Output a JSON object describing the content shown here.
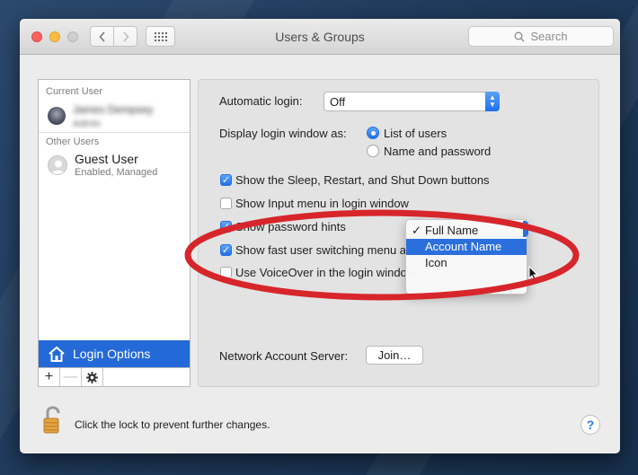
{
  "window": {
    "title": "Users & Groups"
  },
  "toolbar": {
    "search_placeholder": "Search"
  },
  "sidebar": {
    "current_user_label": "Current User",
    "current_user_name": "James Dempsey",
    "current_user_role": "Admin",
    "other_users_label": "Other Users",
    "guest_name": "Guest User",
    "guest_sub": "Enabled, Managed",
    "login_options_label": "Login Options",
    "controls": [
      "+",
      "—",
      "gear-icon"
    ]
  },
  "pane": {
    "automatic_login_label": "Automatic login:",
    "automatic_login_value": "Off",
    "display_login_label": "Display login window as:",
    "radio_list_users": "List of users",
    "radio_name_password": "Name and password",
    "cb_sleep": "Show the Sleep, Restart, and Shut Down buttons",
    "cb_input_menu": "Show Input menu in login window",
    "cb_password_hints": "Show password hints",
    "cb_fast_switch": "Show fast user switching menu as",
    "cb_voiceover": "Use VoiceOver in the login window",
    "network_label": "Network Account Server:",
    "join_button": "Join…",
    "checkbox_states": {
      "sleep": true,
      "input_menu": false,
      "password_hints": true,
      "fast_switch": true,
      "voiceover": false
    }
  },
  "dropdown": {
    "items": [
      "Full Name",
      "Account Name",
      "Icon"
    ],
    "checked": "Full Name",
    "highlighted": "Account Name"
  },
  "footer": {
    "lock_text": "Click the lock to prevent further changes.",
    "help": "?"
  },
  "colors": {
    "accent": "#2469d8",
    "annotation": "#d7262b"
  }
}
